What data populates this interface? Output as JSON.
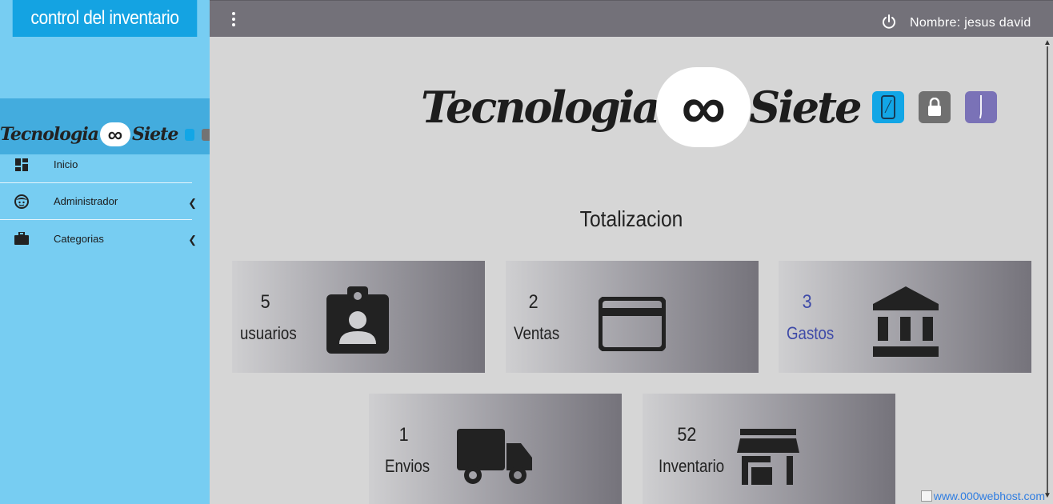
{
  "sidebar": {
    "title": "control del inventario",
    "logo_left": "Tecnologia",
    "logo_right": "Siete",
    "items": [
      {
        "label": "Inicio",
        "icon": "dashboard-icon"
      },
      {
        "label": "Administrador",
        "icon": "face-icon"
      },
      {
        "label": "Categorias",
        "icon": "briefcase-icon"
      }
    ]
  },
  "topbar": {
    "user": "Nombre: jesus david"
  },
  "hero": {
    "left": "Tecnologia",
    "right": "Siete"
  },
  "main": {
    "section_title": "Totalizacion",
    "cards": [
      {
        "value": "5",
        "label": "usuarios",
        "icon": "contact-badge-icon"
      },
      {
        "value": "2",
        "label": "Ventas",
        "icon": "credit-card-icon"
      },
      {
        "value": "3",
        "label": "Gastos",
        "icon": "bank-icon"
      },
      {
        "value": "1",
        "label": "Envios",
        "icon": "truck-icon"
      },
      {
        "value": "52",
        "label": "Inventario",
        "icon": "store-icon"
      }
    ]
  },
  "footer": {
    "webhost": "www.000webhost.com"
  },
  "colors": {
    "sidebar_bg": "#77cdf2",
    "sidebar_header": "#14a3e2",
    "topbar": "#737179",
    "content_bg": "#d6d6d6",
    "accent_blue": "#3e4aa8"
  }
}
